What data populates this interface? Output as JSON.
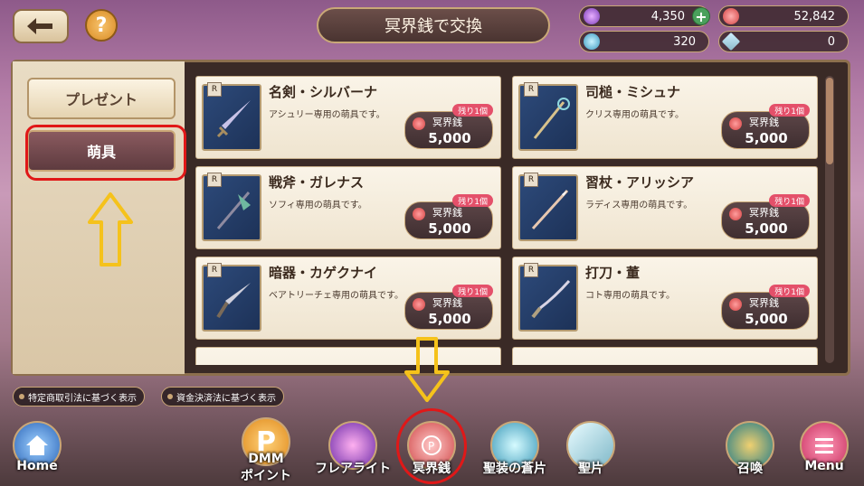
{
  "header": {
    "title": "冥界銭で交換",
    "currencies": [
      {
        "name": "top-left",
        "value": "4,350"
      },
      {
        "name": "top-right",
        "value": "52,842"
      },
      {
        "name": "bottom-left",
        "value": "320"
      },
      {
        "name": "bottom-right",
        "value": "0"
      }
    ],
    "help_label": "?"
  },
  "sidebar": {
    "tabs": [
      {
        "label": "プレゼント"
      },
      {
        "label": "萌具"
      }
    ]
  },
  "items": [
    {
      "rarity": "R",
      "name": "名剣・シルバーナ",
      "desc": "アシュリー専用の萌具です。",
      "remain": "残り1個",
      "currency": "冥界銭",
      "price": "5,000",
      "weapon": "sword-icon"
    },
    {
      "rarity": "R",
      "name": "司槌・ミシュナ",
      "desc": "クリス専用の萌具です。",
      "remain": "残り1個",
      "currency": "冥界銭",
      "price": "5,000",
      "weapon": "staff-icon"
    },
    {
      "rarity": "R",
      "name": "戦斧・ガレナス",
      "desc": "ソフィ専用の萌具です。",
      "remain": "残り1個",
      "currency": "冥界銭",
      "price": "5,000",
      "weapon": "axe-icon"
    },
    {
      "rarity": "R",
      "name": "習杖・アリッシア",
      "desc": "ラディス専用の萌具です。",
      "remain": "残り1個",
      "currency": "冥界銭",
      "price": "5,000",
      "weapon": "spear-icon"
    },
    {
      "rarity": "R",
      "name": "暗器・カゲクナイ",
      "desc": "ベアトリーチェ専用の萌具です。",
      "remain": "残り1個",
      "currency": "冥界銭",
      "price": "5,000",
      "weapon": "kunai-icon"
    },
    {
      "rarity": "R",
      "name": "打刀・董",
      "desc": "コト専用の萌具です。",
      "remain": "残り1個",
      "currency": "冥界銭",
      "price": "5,000",
      "weapon": "katana-icon"
    }
  ],
  "legal": {
    "left": "特定商取引法に基づく表示",
    "right": "資金決済法に基づく表示"
  },
  "nav": {
    "home": "Home",
    "dmm_top": "DMM",
    "dmm_bottom": "ポイント",
    "flare": "フレアライト",
    "meikai": "冥界銭",
    "seiso": "聖装の蒼片",
    "seihen": "聖片",
    "shokan": "召喚",
    "menu": "Menu",
    "p_letter": "P"
  },
  "colors": {
    "highlight": "#e01818",
    "arrow": "#f5c21b",
    "remain_badge": "#e4506a"
  }
}
